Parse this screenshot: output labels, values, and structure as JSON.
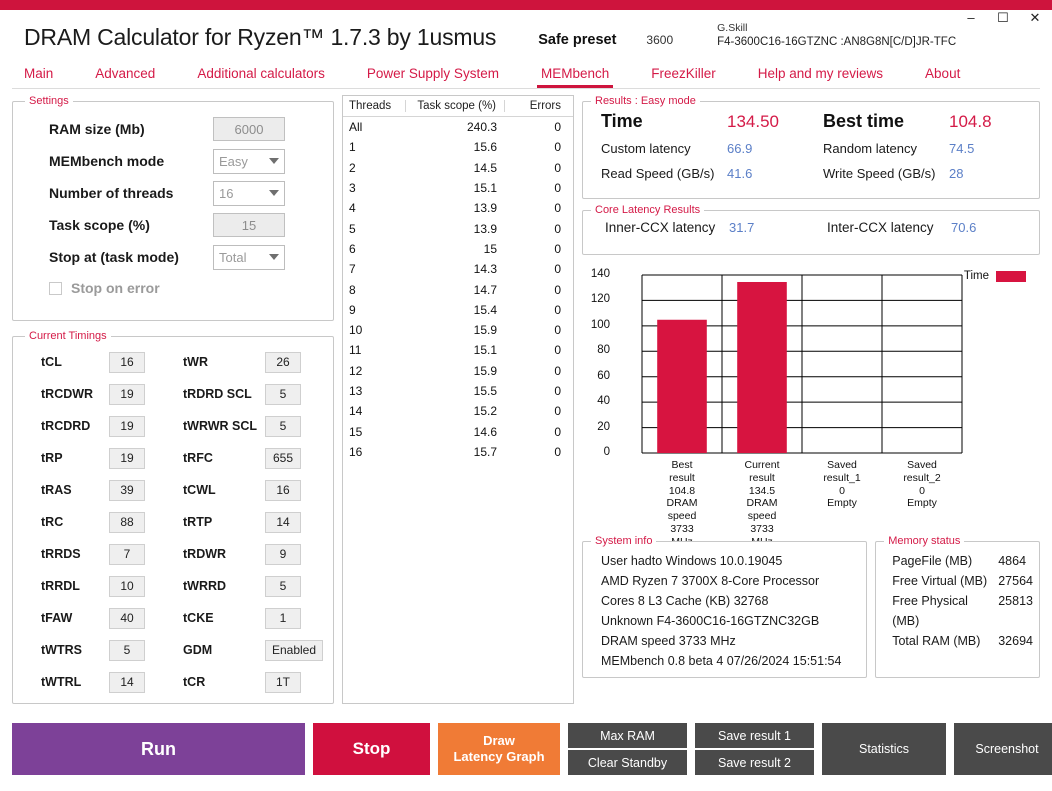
{
  "window": {
    "minimize_icon": "minimize-icon",
    "maximize_icon": "maximize-icon",
    "close_icon": "close-icon",
    "minimize_glyph": "–",
    "maximize_glyph": "☐",
    "close_glyph": "✕",
    "accent_color": "#ce143d"
  },
  "header": {
    "title": "DRAM Calculator for Ryzen™ 1.7.3 by 1usmus",
    "preset_label": "Safe preset",
    "preset_frequency": "3600",
    "memory_brand": "G.Skill",
    "memory_part_number": "F4-3600C16-16GTZNC :AN8G8N[C/D]JR-TFC"
  },
  "nav": {
    "tabs": [
      {
        "label": "Main",
        "active": false
      },
      {
        "label": "Advanced",
        "active": false
      },
      {
        "label": "Additional calculators",
        "active": false
      },
      {
        "label": "Power Supply System",
        "active": false
      },
      {
        "label": "MEMbench",
        "active": true
      },
      {
        "label": "FreezKiller",
        "active": false
      },
      {
        "label": "Help and my reviews",
        "active": false
      },
      {
        "label": "About",
        "active": false
      }
    ]
  },
  "settings": {
    "legend": "Settings",
    "rows": [
      {
        "label": "RAM size (Mb)",
        "value": "6000",
        "type": "text"
      },
      {
        "label": "MEMbench mode",
        "value": "Easy",
        "type": "combo"
      },
      {
        "label": "Number of threads",
        "value": "16",
        "type": "combo"
      },
      {
        "label": "Task scope (%)",
        "value": "15",
        "type": "text"
      },
      {
        "label": "Stop at (task mode)",
        "value": "Total",
        "type": "combo"
      }
    ],
    "stop_on_error_label": "Stop on error",
    "stop_on_error_checked": false
  },
  "timings": {
    "legend": "Current Timings",
    "left": [
      {
        "label": "tCL",
        "value": "16"
      },
      {
        "label": "tRCDWR",
        "value": "19"
      },
      {
        "label": "tRCDRD",
        "value": "19"
      },
      {
        "label": "tRP",
        "value": "19"
      },
      {
        "label": "tRAS",
        "value": "39"
      },
      {
        "label": "tRC",
        "value": "88"
      },
      {
        "label": "tRRDS",
        "value": "7"
      },
      {
        "label": "tRRDL",
        "value": "10"
      },
      {
        "label": "tFAW",
        "value": "40"
      },
      {
        "label": "tWTRS",
        "value": "5"
      },
      {
        "label": "tWTRL",
        "value": "14"
      }
    ],
    "right": [
      {
        "label": "tWR",
        "value": "26"
      },
      {
        "label": "tRDRD SCL",
        "value": "5"
      },
      {
        "label": "tWRWR SCL",
        "value": "5"
      },
      {
        "label": "tRFC",
        "value": "655"
      },
      {
        "label": "tCWL",
        "value": "16"
      },
      {
        "label": "tRTP",
        "value": "14"
      },
      {
        "label": "tRDWR",
        "value": "9"
      },
      {
        "label": "tWRRD",
        "value": "5"
      },
      {
        "label": "tCKE",
        "value": "1"
      },
      {
        "label": "GDM",
        "value": "Enabled"
      },
      {
        "label": "tCR",
        "value": "1T"
      }
    ]
  },
  "threads_table": {
    "columns": [
      "Threads",
      "Task scope (%)",
      "Errors"
    ],
    "rows": [
      {
        "thread": "All",
        "scope": "240.3",
        "errors": "0"
      },
      {
        "thread": "1",
        "scope": "15.6",
        "errors": "0"
      },
      {
        "thread": "2",
        "scope": "14.5",
        "errors": "0"
      },
      {
        "thread": "3",
        "scope": "15.1",
        "errors": "0"
      },
      {
        "thread": "4",
        "scope": "13.9",
        "errors": "0"
      },
      {
        "thread": "5",
        "scope": "13.9",
        "errors": "0"
      },
      {
        "thread": "6",
        "scope": "15",
        "errors": "0"
      },
      {
        "thread": "7",
        "scope": "14.3",
        "errors": "0"
      },
      {
        "thread": "8",
        "scope": "14.7",
        "errors": "0"
      },
      {
        "thread": "9",
        "scope": "15.4",
        "errors": "0"
      },
      {
        "thread": "10",
        "scope": "15.9",
        "errors": "0"
      },
      {
        "thread": "11",
        "scope": "15.1",
        "errors": "0"
      },
      {
        "thread": "12",
        "scope": "15.9",
        "errors": "0"
      },
      {
        "thread": "13",
        "scope": "15.5",
        "errors": "0"
      },
      {
        "thread": "14",
        "scope": "15.2",
        "errors": "0"
      },
      {
        "thread": "15",
        "scope": "14.6",
        "errors": "0"
      },
      {
        "thread": "16",
        "scope": "15.7",
        "errors": "0"
      }
    ]
  },
  "results": {
    "legend": "Results : Easy mode",
    "time_label": "Time",
    "time_value": "134.50",
    "best_time_label": "Best time",
    "best_time_value": "104.8",
    "custom_latency_label": "Custom latency",
    "custom_latency_value": "66.9",
    "random_latency_label": "Random latency",
    "random_latency_value": "74.5",
    "read_speed_label": "Read Speed (GB/s)",
    "read_speed_value": "41.6",
    "write_speed_label": "Write Speed (GB/s)",
    "write_speed_value": "28"
  },
  "core_latency": {
    "legend": "Core Latency Results",
    "inner_label": "Inner-CCX latency",
    "inner_value": "31.7",
    "inter_label": "Inter-CCX latency",
    "inter_value": "70.6"
  },
  "chart_data": {
    "type": "bar",
    "title": "",
    "xlabel": "",
    "ylabel": "",
    "ylim": [
      0,
      140
    ],
    "yticks": [
      0,
      20,
      40,
      60,
      80,
      100,
      120,
      140
    ],
    "grid": true,
    "legend_position": "right",
    "series": [
      {
        "name": "Time",
        "color": "#d71440",
        "values": [
          104.8,
          134.5,
          0,
          0
        ]
      }
    ],
    "categories": [
      "Best result",
      "Current result",
      "Saved result_1",
      "Saved result_2"
    ],
    "category_labels": [
      [
        "Best",
        "result",
        "104.8",
        "DRAM",
        "speed",
        "3733",
        "MHz"
      ],
      [
        "Current",
        "result",
        "134.5",
        "DRAM",
        "speed",
        "3733",
        "MHz"
      ],
      [
        "Saved",
        "result_1",
        "0",
        "Empty"
      ],
      [
        "Saved",
        "result_2",
        "0",
        "Empty"
      ]
    ]
  },
  "system_info": {
    "legend": "System info",
    "lines": [
      "User hadto                    Windows 10.0.19045",
      "AMD Ryzen 7 3700X 8-Core Processor",
      "Cores 8      L3 Cache (KB)      32768",
      "Unknown F4-3600C16-16GTZNC32GB",
      "DRAM speed 3733 MHz",
      "MEMbench 0.8 beta 4      07/26/2024 15:51:54"
    ]
  },
  "memory_status": {
    "legend": "Memory status",
    "rows": [
      {
        "label": "PageFile (MB)",
        "value": "4864"
      },
      {
        "label": "Free Virtual (MB)",
        "value": "27564"
      },
      {
        "label": "Free Physical (MB)",
        "value": "25813"
      },
      {
        "label": "Total RAM (MB)",
        "value": "32694"
      }
    ]
  },
  "buttons": {
    "run": "Run",
    "stop": "Stop",
    "draw_line1": "Draw",
    "draw_line2": "Latency Graph",
    "max_ram": "Max RAM",
    "clear_standby": "Clear Standby",
    "save_result_1": "Save result 1",
    "save_result_2": "Save result 2",
    "statistics": "Statistics",
    "screenshot": "Screenshot"
  }
}
